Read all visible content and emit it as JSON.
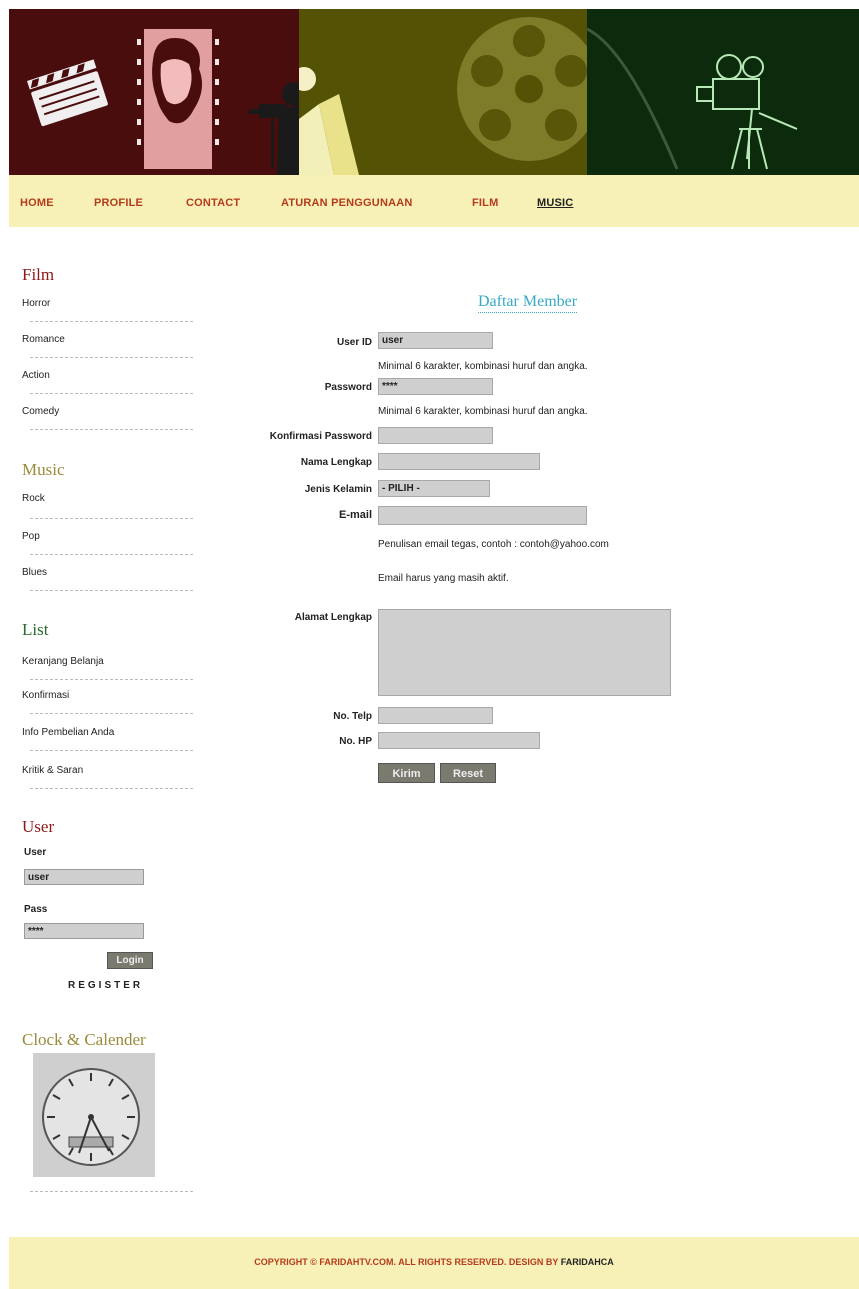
{
  "nav": {
    "items": [
      "HOME",
      "PROFILE",
      "CONTACT",
      "ATURAN PENGGUNAAN",
      "FILM",
      "MUSIC"
    ],
    "active": "MUSIC"
  },
  "sidebar": {
    "film": {
      "heading": "Film",
      "items": [
        "Horror",
        "Romance",
        "Action",
        "Comedy"
      ]
    },
    "music": {
      "heading": "Music",
      "items": [
        "Rock",
        "Pop",
        "Blues"
      ]
    },
    "list": {
      "heading": "List",
      "items": [
        "Keranjang Belanja",
        "Konfirmasi",
        "Info Pembelian Anda",
        "Kritik & Saran"
      ]
    },
    "user": {
      "heading": "User",
      "user_label": "User",
      "user_value": "user",
      "pass_label": "Pass",
      "pass_value": "****",
      "login_label": "Login",
      "register_label": "REGISTER"
    },
    "clock": {
      "heading": "Clock & Calender"
    }
  },
  "form": {
    "title": "Daftar Member",
    "user_id_label": "User ID",
    "user_id_value": "user",
    "hint1": "Minimal 6 karakter, kombinasi huruf dan angka.",
    "password_label": "Password",
    "password_value": "****",
    "hint2": "Minimal 6 karakter, kombinasi huruf dan angka.",
    "confirm_label": "Konfirmasi Password",
    "fullname_label": "Nama Lengkap",
    "gender_label": "Jenis Kelamin",
    "gender_value": "- PILIH -",
    "email_label": "E-mail",
    "email_hint1": "Penulisan email tegas, contoh : contoh@yahoo.com",
    "email_hint2": "Email harus yang masih aktif.",
    "address_label": "Alamat Lengkap",
    "phone_label": "No. Telp",
    "hp_label": "No. HP",
    "submit_label": "Kirim",
    "reset_label": "Reset"
  },
  "footer": {
    "text": "COPYRIGHT © FARIDAHTV.COM. ALL RIGHTS RESERVED. DESIGN BY",
    "designer": "FARIDAHCA"
  },
  "colors": {
    "banner_red": "#4a0d0d",
    "banner_olive": "#545205",
    "banner_green": "#0c2b0c",
    "nav_bg": "#f7f1b8",
    "nav_link": "#b43b1b",
    "heading_film": "#8b1a1a",
    "heading_music": "#9a8a3a",
    "heading_list": "#2a6a2a",
    "heading_user": "#8b1a1a",
    "heading_clock": "#9a8a3a",
    "form_title": "#38a8c6"
  }
}
